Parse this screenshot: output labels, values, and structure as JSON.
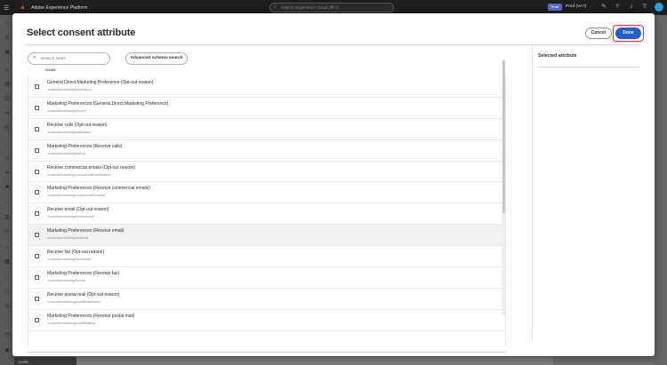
{
  "app": {
    "title": "Adobe Experience Platform",
    "search_placeholder": "Search Experience Cloud (⌘+/)",
    "env_badge": "Prod",
    "sandbox": "Prod (VA7)"
  },
  "bottom_label": "Audits",
  "modal": {
    "title": "Select consent attribute",
    "cancel_label": "Cancel",
    "done_label": "Done",
    "search_placeholder": "Search fields",
    "advanced_search_label": "Advanced schema search",
    "column_header": "NAME",
    "selected_panel_title": "Selected attribute",
    "rows": [
      {
        "name": "General Direct Marketing Preference (Opt-out reason)",
        "path": "consents/marketing/any/reason"
      },
      {
        "name": "Marketing Preferences (General Direct Marketing Preference)",
        "path": "consents/marketing/any/val"
      },
      {
        "name": "Receive calls (Opt-out reason)",
        "path": "consents/marketing/call/reason"
      },
      {
        "name": "Marketing Preferences (Receive calls)",
        "path": "consents/marketing/call/val"
      },
      {
        "name": "Receive commercial emails (Opt-out reason)",
        "path": "consents/marketing/commercialEmail/reason"
      },
      {
        "name": "Marketing Preferences (Receive commercial emails)",
        "path": "consents/marketing/commercialEmail/val"
      },
      {
        "name": "Receive email (Opt-out reason)",
        "path": "consents/marketing/email/reason"
      },
      {
        "name": "Marketing Preferences (Receive email)",
        "path": "consents/marketing/email/val"
      },
      {
        "name": "Receive fax (Opt-out reason)",
        "path": "consents/marketing/fax/reason"
      },
      {
        "name": "Marketing Preferences (Receive fax)",
        "path": "consents/marketing/fax/val"
      },
      {
        "name": "Receive postal mail (Opt-out reason)",
        "path": "consents/marketing/postalMail/reason"
      },
      {
        "name": "Marketing Preferences (Receive postal mail)",
        "path": "consents/marketing/postalMail/val"
      },
      {
        "name": "",
        "path": ""
      }
    ]
  }
}
